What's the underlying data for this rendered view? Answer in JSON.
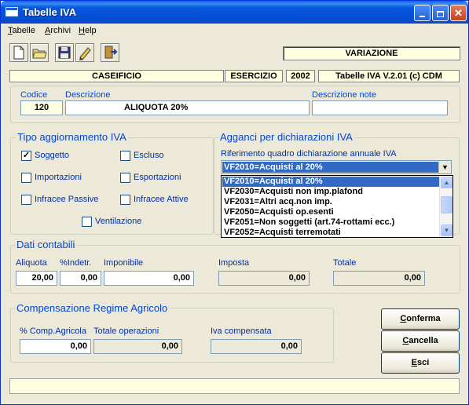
{
  "window": {
    "title": "Tabelle IVA"
  },
  "menu": [
    {
      "label": "Tabelle",
      "key": "T",
      "rest": "abelle"
    },
    {
      "label": "Archivi",
      "key": "A",
      "rest": "rchivi"
    },
    {
      "label": "Help",
      "key": "H",
      "rest": "elp"
    }
  ],
  "toolbar": {
    "icons": [
      "new-document-icon",
      "open-folder-icon",
      "save-icon",
      "edit-pencil-icon",
      "exit-door-icon"
    ],
    "mode": "VARIAZIONE"
  },
  "info": {
    "company": "CASEIFICIO",
    "esercizio_label": "ESERCIZIO",
    "esercizio_value": "2002",
    "version": "Tabelle IVA V.2.01 (c) CDM"
  },
  "record": {
    "codice_label": "Codice",
    "codice_value": "120",
    "descrizione_label": "Descrizione",
    "descrizione_value": "ALIQUOTA 20%",
    "descrizione_note_label": "Descrizione note",
    "descrizione_note_value": ""
  },
  "tipo": {
    "title": "Tipo aggiornamento IVA",
    "soggetto": {
      "label": "Soggetto",
      "checked": true
    },
    "escluso": {
      "label": "Escluso",
      "checked": false
    },
    "importazioni": {
      "label": "Importazioni",
      "checked": false
    },
    "esportazioni": {
      "label": "Esportazioni",
      "checked": false
    },
    "infracee_passive": {
      "label": "Infracee Passive",
      "checked": false
    },
    "infracee_attive": {
      "label": "Infracee Attive",
      "checked": false
    },
    "ventilazione": {
      "label": "Ventilazione",
      "checked": false
    }
  },
  "agganci": {
    "title": "Agganci per dichiarazioni IVA",
    "subtitle": "Riferimento quadro dichiarazione annuale IVA",
    "selected": "VF2010=Acquisti al 20%",
    "options": [
      "VF2010=Acquisti al 20%",
      "VF2030=Acquisti non imp.plafond",
      "VF2031=Altri acq.non imp.",
      "VF2050=Acquisti op.esenti",
      "VF2051=Non soggetti (art.74-rottami ecc.)",
      "VF2052=Acquisti terremotati"
    ]
  },
  "dati": {
    "title": "Dati contabili",
    "aliquota_label": "Aliquota",
    "aliquota_value": "20,00",
    "indetr_label": "%Indetr.",
    "indetr_value": "0,00",
    "imponibile_label": "Imponibile",
    "imponibile_value": "0,00",
    "imposta_label": "Imposta",
    "imposta_value": "0,00",
    "totale_label": "Totale",
    "totale_value": "0,00"
  },
  "compensazione": {
    "title": "Compensazione Regime Agricolo",
    "comp_label": "% Comp.Agricola",
    "comp_value": "0,00",
    "totale_op_label": "Totale operazioni",
    "totale_op_value": "0,00",
    "iva_comp_label": "Iva compensata",
    "iva_comp_value": "0,00"
  },
  "buttons": {
    "conferma": {
      "key": "C",
      "rest": "onferma"
    },
    "cancella": {
      "key": "C",
      "rest": "ancella"
    },
    "esci": {
      "key": "E",
      "rest": "sci"
    }
  },
  "statusbar": ""
}
